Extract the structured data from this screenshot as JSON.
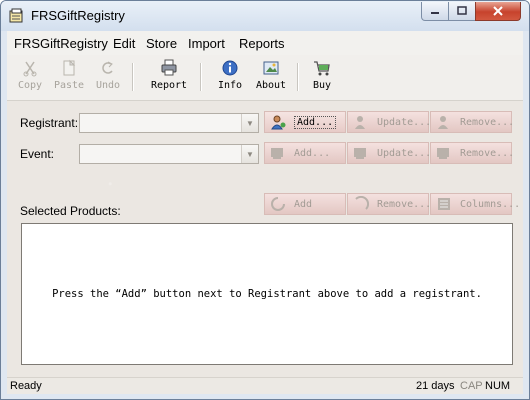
{
  "window": {
    "title": "FRSGiftRegistry"
  },
  "menu": [
    "FRSGiftRegistry",
    "Edit",
    "Store",
    "Import",
    "Reports"
  ],
  "toolbar": {
    "copy": "Copy",
    "paste": "Paste",
    "undo": "Undo",
    "report": "Report",
    "info": "Info",
    "about": "About",
    "buy": "Buy"
  },
  "registrant": {
    "label": "Registrant:",
    "add": "Add...",
    "update": "Update...",
    "remove": "Remove..."
  },
  "event": {
    "label": "Event:",
    "add": "Add...",
    "update": "Update...",
    "remove": "Remove..."
  },
  "products": {
    "label": "Selected Products:",
    "add": "Add",
    "remove": "Remove...",
    "columns": "Columns...",
    "empty_message": "Press the “Add” button next to Registrant above to add a registrant."
  },
  "status": {
    "text": "Ready",
    "days": "21 days",
    "cap": "CAP",
    "num": "NUM"
  },
  "colors": {
    "title_bg": "#d3dfee",
    "close_button": "#c7432d",
    "button_bg": "#e3c7c3"
  }
}
